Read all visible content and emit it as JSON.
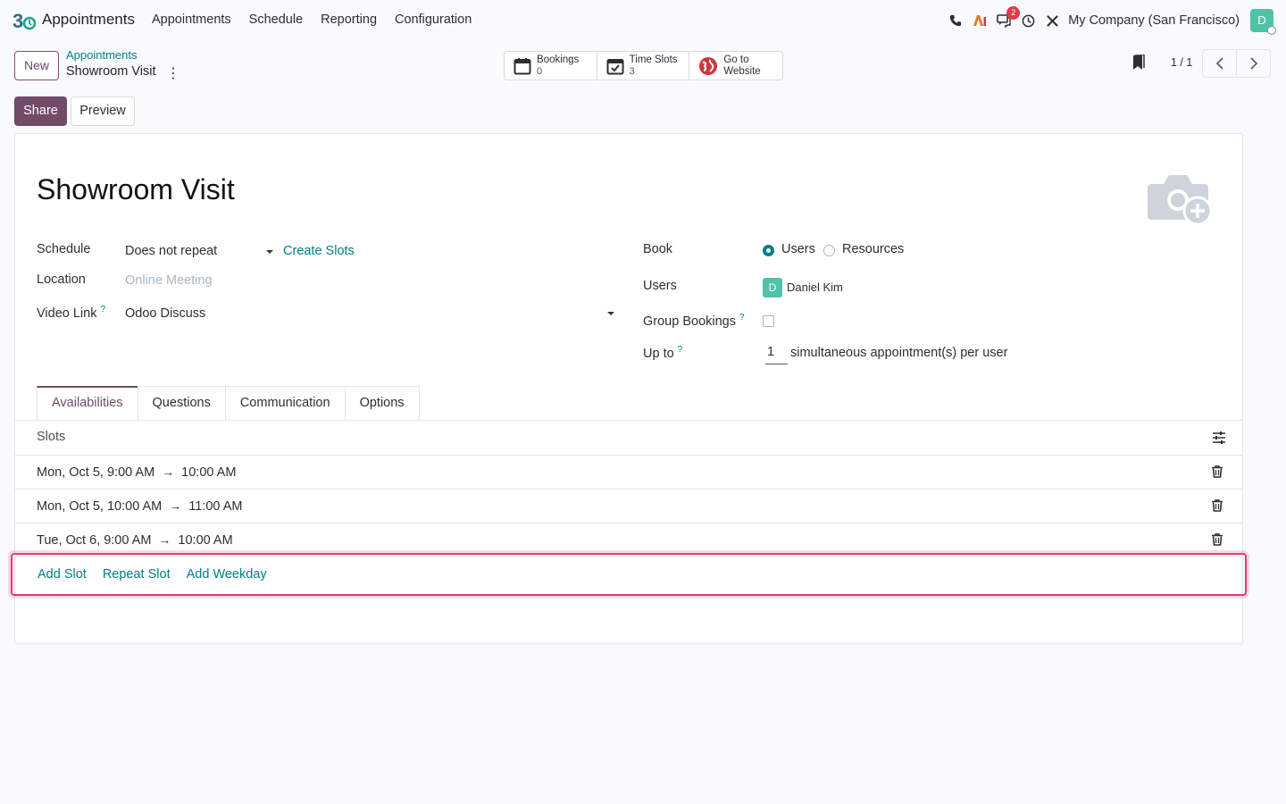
{
  "navbar": {
    "app_name": "Appointments",
    "menu": [
      "Appointments",
      "Schedule",
      "Reporting",
      "Configuration"
    ],
    "company": "My Company (San Francisco)",
    "avatar_initial": "D",
    "messages_badge": "2",
    "icons": [
      "phone-icon",
      "ai-icon",
      "messages-icon",
      "clock-icon",
      "tools-icon"
    ]
  },
  "control_panel": {
    "new_label": "New",
    "breadcrumb_parent": "Appointments",
    "breadcrumb_current": "Showroom Visit",
    "smart_buttons": [
      {
        "label": "Bookings",
        "value": "0",
        "icon": "calendar-icon"
      },
      {
        "label": "Time Slots",
        "value": "3",
        "icon": "calendar-check-icon"
      },
      {
        "label": "Go to",
        "value": "Website",
        "icon": "globe-icon"
      }
    ],
    "pager": "1 / 1",
    "share_label": "Share",
    "preview_label": "Preview"
  },
  "form": {
    "title": "Showroom Visit",
    "schedule_label": "Schedule",
    "schedule_value": "Does not repeat",
    "create_slots_label": "Create Slots",
    "location_label": "Location",
    "location_placeholder": "Online Meeting",
    "video_link_label": "Video Link",
    "video_link_help": "?",
    "video_link_value": "Odoo Discuss",
    "book_label": "Book",
    "book_options": [
      "Users",
      "Resources"
    ],
    "book_selected": "Users",
    "users_label": "Users",
    "user_initial": "D",
    "user_name": "Daniel Kim",
    "group_bookings_label": "Group Bookings",
    "group_bookings_help": "?",
    "group_bookings_checked": false,
    "up_to_label": "Up to",
    "up_to_help": "?",
    "up_to_value": "1",
    "up_to_suffix": "simultaneous appointment(s) per user"
  },
  "tabs": [
    {
      "label": "Availabilities",
      "active": true
    },
    {
      "label": "Questions",
      "active": false
    },
    {
      "label": "Communication",
      "active": false
    },
    {
      "label": "Options",
      "active": false
    }
  ],
  "slots": {
    "header": "Slots",
    "rows": [
      {
        "start": "Mon, Oct 5, 9:00 AM",
        "end": "10:00 AM"
      },
      {
        "start": "Mon, Oct 5, 10:00 AM",
        "end": "11:00 AM"
      },
      {
        "start": "Tue, Oct 6, 9:00 AM",
        "end": "10:00 AM"
      }
    ],
    "actions": [
      "Add Slot",
      "Repeat Slot",
      "Add Weekday"
    ]
  },
  "colors": {
    "brand": "#714b67",
    "link": "#017e84",
    "highlight": "#e03b7a",
    "avatar": "#4fc2a8"
  }
}
